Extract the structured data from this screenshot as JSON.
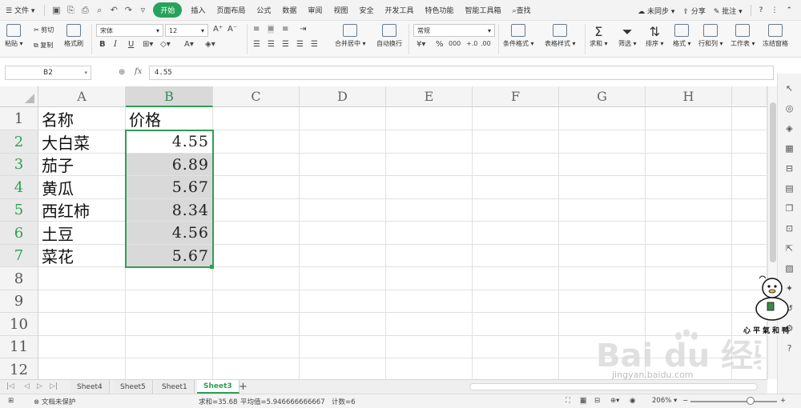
{
  "menubar": {
    "file_label": "文件",
    "tabs": [
      {
        "label": "开始",
        "active": true
      },
      {
        "label": "插入"
      },
      {
        "label": "页面布局"
      },
      {
        "label": "公式"
      },
      {
        "label": "数据"
      },
      {
        "label": "审阅"
      },
      {
        "label": "视图"
      },
      {
        "label": "安全"
      },
      {
        "label": "开发工具"
      },
      {
        "label": "特色功能"
      },
      {
        "label": "智能工具箱"
      },
      {
        "label": "查找"
      }
    ],
    "sync_label": "未同步",
    "share_label": "分享",
    "comment_label": "批注",
    "help_label": "?"
  },
  "ribbon": {
    "paste_label": "粘贴",
    "cut_label": "剪切",
    "copy_label": "复制",
    "format_painter_label": "格式刷",
    "font_name": "宋体",
    "font_size": "12",
    "merge_label": "合并居中",
    "wrap_label": "自动换行",
    "number_format": "常规",
    "cond_format_label": "条件格式",
    "table_style_label": "表格样式",
    "sum_label": "求和",
    "filter_label": "筛选",
    "sort_label": "排序",
    "format_label": "格式",
    "rowcol_label": "行和列",
    "worksheet_label": "工作表",
    "freeze_label": "冻结窗格",
    "bold": "B",
    "italic": "I",
    "underline": "U",
    "percent": "%",
    "thousands": "000"
  },
  "formula_bar": {
    "cell_ref": "B2",
    "fx_label": "fx",
    "value": "4.55"
  },
  "grid": {
    "columns": [
      "A",
      "B",
      "C",
      "D",
      "E",
      "F",
      "G",
      "H"
    ],
    "rows": [
      "1",
      "2",
      "3",
      "4",
      "5",
      "6",
      "7",
      "8",
      "9",
      "10",
      "11",
      "12"
    ],
    "cells": {
      "A1": "名称",
      "B1": "价格",
      "A2": "大白菜",
      "B2": "4.55",
      "A3": "茄子",
      "B3": "6.89",
      "A4": "黄瓜",
      "B4": "5.67",
      "A5": "西红柿",
      "B5": "8.34",
      "A6": "土豆",
      "B6": "4.56",
      "A7": "菜花",
      "B7": "5.67"
    }
  },
  "sheets": [
    {
      "label": "Sheet4"
    },
    {
      "label": "Sheet5"
    },
    {
      "label": "Sheet1"
    },
    {
      "label": "Sheet3",
      "active": true
    }
  ],
  "status": {
    "protect_label": "文档未保护",
    "sum_text": "求和=35.68",
    "avg_text": "平均值=5.946666666667",
    "count_text": "计数=6",
    "zoom": "206%"
  },
  "watermark": {
    "duck_caption": "心平氣和鸭",
    "site_text": "Bai du 经验",
    "site_url": "jingyan.baidu.com"
  },
  "colors": {
    "accent": "#2e9e55",
    "selection_fill": "#d9d9d9"
  }
}
